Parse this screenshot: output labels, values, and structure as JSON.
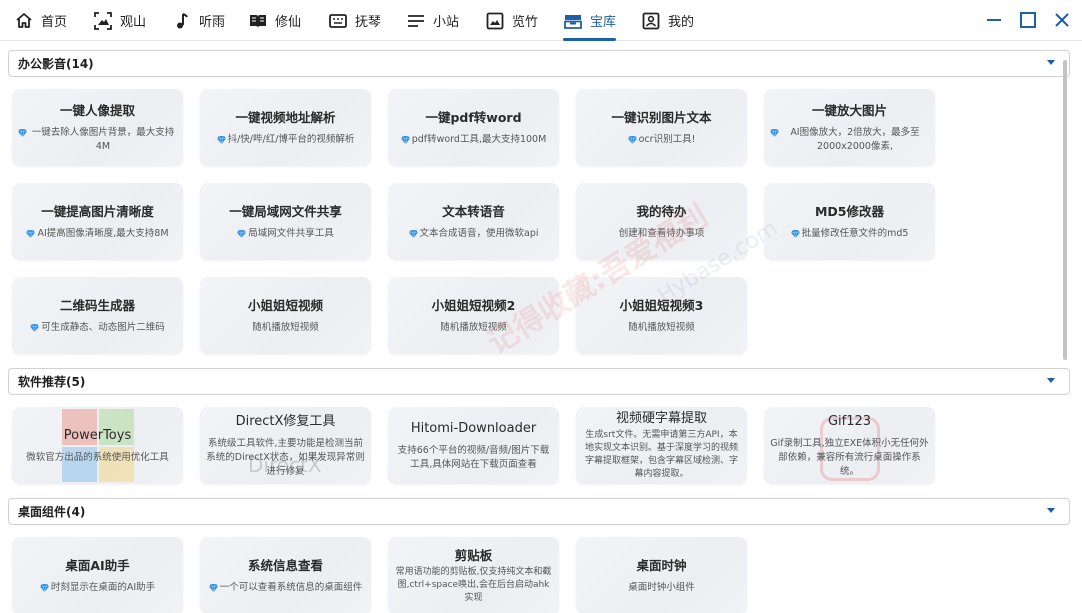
{
  "nav": {
    "items": [
      {
        "label": "首页",
        "icon": "home-icon"
      },
      {
        "label": "观山",
        "icon": "mountain-view-icon"
      },
      {
        "label": "听雨",
        "icon": "music-note-icon"
      },
      {
        "label": "修仙",
        "icon": "book-icon"
      },
      {
        "label": "抚琴",
        "icon": "keyboard-icon"
      },
      {
        "label": "小站",
        "icon": "list-lines-icon"
      },
      {
        "label": "览竹",
        "icon": "image-icon"
      },
      {
        "label": "宝库",
        "icon": "treasure-box-icon",
        "active": true
      },
      {
        "label": "我的",
        "icon": "profile-card-icon"
      }
    ],
    "accent_color": "#1f5fa8"
  },
  "sections": [
    {
      "title": "办公影音(14)",
      "cards": [
        {
          "title": "一键人像提取",
          "desc": "一键去除人像图片背景，最大支持4M",
          "gem": true
        },
        {
          "title": "一键视频地址解析",
          "desc": "抖/快/哔/红/博平台的视频解析",
          "gem": true
        },
        {
          "title": "一键pdf转word",
          "desc": "pdf转word工具,最大支持100M",
          "gem": true
        },
        {
          "title": "一键识别图片文本",
          "desc": "ocr识别工具!",
          "gem": true
        },
        {
          "title": "一键放大图片",
          "desc": "AI图像放大，2倍放大，最多至2000x2000像素,",
          "gem": true
        },
        {
          "title": "一键提高图片清晰度",
          "desc": "AI提高图像清晰度,最大支持8M",
          "gem": true
        },
        {
          "title": "一键局域网文件共享",
          "desc": "局域网文件共享工具",
          "gem": true
        },
        {
          "title": "文本转语音",
          "desc": "文本合成语音，使用微软api",
          "gem": true
        },
        {
          "title": "我的待办",
          "desc": "创建和查看待办事项",
          "gem": false
        },
        {
          "title": "MD5修改器",
          "desc": "批量修改任意文件的md5",
          "gem": true
        },
        {
          "title": "二维码生成器",
          "desc": "可生成静态、动态图片二维码",
          "gem": true
        },
        {
          "title": "小姐姐短视频",
          "desc": "随机播放短视频",
          "gem": false
        },
        {
          "title": "小姐姐短视频2",
          "desc": "随机播放短视频",
          "gem": false
        },
        {
          "title": "小姐姐短视频3",
          "desc": "随机播放短视频",
          "gem": false
        }
      ]
    },
    {
      "title": "软件推荐(5)",
      "cards": [
        {
          "title": "PowerToys",
          "desc": "微软官方出品的系统使用优化工具",
          "gem": false
        },
        {
          "title": "DirectX修复工具",
          "desc": "系统级工具软件,主要功能是检测当前系统的DirectX状态，如果发现异常则进行修复",
          "gem": false
        },
        {
          "title": "Hitomi-Downloader",
          "desc": "支持66个平台的视频/音频/图片下载工具,具体网站在下载页面查看",
          "gem": false
        },
        {
          "title": "视频硬字幕提取",
          "desc": "生成srt文件。无需申请第三方API，本地实现文本识别。基于深度学习的视频字幕提取框架，包含字幕区域检测、字幕内容提取。",
          "gem": false
        },
        {
          "title": "Gif123",
          "desc": "Gif录制工具,独立EXE体积小无任何外部依赖，兼容所有流行桌面操作系统。",
          "gem": false
        }
      ]
    },
    {
      "title": "桌面组件(4)",
      "cards": [
        {
          "title": "桌面AI助手",
          "desc": "时刻显示在桌面的AI助手",
          "gem": true
        },
        {
          "title": "系统信息查看",
          "desc": "一个可以查看系统信息的桌面组件",
          "gem": true
        },
        {
          "title": "剪贴板",
          "desc": "常用语功能的剪贴板,仅支持纯文本和截图,ctrl+space唤出,会在后台启动ahk实现",
          "gem": false
        },
        {
          "title": "桌面时钟",
          "desc": "桌面时钟小组件",
          "gem": false
        }
      ]
    }
  ],
  "watermark": {
    "text": "记得收藏:吾爱福利",
    "text2": "Hybase.com"
  },
  "logos": {
    "powertoys": "PowerToys",
    "directx": "DirectX"
  }
}
